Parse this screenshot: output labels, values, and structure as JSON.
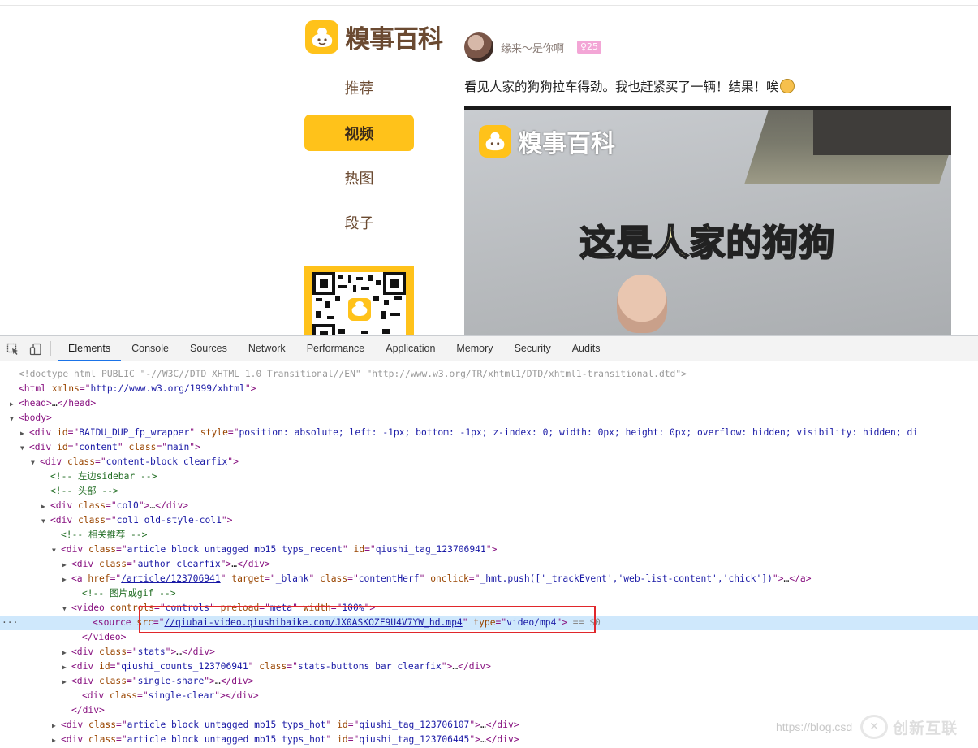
{
  "site": {
    "logo_text": "糗事百科",
    "nav": [
      "推荐",
      "视频",
      "热图",
      "段子"
    ],
    "active_nav": "视频"
  },
  "post": {
    "author_name": "缘来～是你啊",
    "author_age": "♀25",
    "text": "看见人家的狗狗拉车得劲。我也赶紧买了一辆！结果！唉",
    "video_watermark": "糗事百科",
    "video_caption": "这是人家的狗狗"
  },
  "devtools": {
    "tabs": [
      "Elements",
      "Console",
      "Sources",
      "Network",
      "Performance",
      "Application",
      "Memory",
      "Security",
      "Audits"
    ],
    "active_tab": "Elements",
    "lines": [
      {
        "indent": 0,
        "tri": "",
        "parts": [
          [
            "doc",
            "<!doctype html PUBLIC \"-//W3C//DTD XHTML 1.0 Transitional//EN\" \"http://www.w3.org/TR/xhtml1/DTD/xhtml1-transitional.dtd\">"
          ]
        ]
      },
      {
        "indent": 0,
        "tri": "",
        "parts": [
          [
            "tag",
            "<html "
          ],
          [
            "attr",
            "xmlns"
          ],
          [
            "tag",
            "=\""
          ],
          [
            "val",
            "http://www.w3.org/1999/xhtml"
          ],
          [
            "tag",
            "\">"
          ]
        ]
      },
      {
        "indent": 0,
        "tri": "▶",
        "parts": [
          [
            "tag",
            "<head>"
          ],
          [
            "",
            "…"
          ],
          [
            "tag",
            "</head>"
          ]
        ]
      },
      {
        "indent": 0,
        "tri": "▼",
        "parts": [
          [
            "tag",
            "<body>"
          ]
        ]
      },
      {
        "indent": 1,
        "tri": "▶",
        "parts": [
          [
            "tag",
            "<div "
          ],
          [
            "attr",
            "id"
          ],
          [
            "tag",
            "=\""
          ],
          [
            "val",
            "BAIDU_DUP_fp_wrapper"
          ],
          [
            "tag",
            "\" "
          ],
          [
            "attr",
            "style"
          ],
          [
            "tag",
            "=\""
          ],
          [
            "val",
            "position: absolute; left: -1px; bottom: -1px; z-index: 0; width: 0px; height: 0px; overflow: hidden; visibility: hidden; di"
          ]
        ]
      },
      {
        "indent": 1,
        "tri": "▼",
        "parts": [
          [
            "tag",
            "<div "
          ],
          [
            "attr",
            "id"
          ],
          [
            "tag",
            "=\""
          ],
          [
            "val",
            "content"
          ],
          [
            "tag",
            "\" "
          ],
          [
            "attr",
            "class"
          ],
          [
            "tag",
            "=\""
          ],
          [
            "val",
            "main"
          ],
          [
            "tag",
            "\">"
          ]
        ]
      },
      {
        "indent": 2,
        "tri": "▼",
        "parts": [
          [
            "tag",
            "<div "
          ],
          [
            "attr",
            "class"
          ],
          [
            "tag",
            "=\""
          ],
          [
            "val",
            "content-block clearfix"
          ],
          [
            "tag",
            "\">"
          ]
        ]
      },
      {
        "indent": 3,
        "tri": "",
        "parts": [
          [
            "cmt",
            "<!-- 左边sidebar -->"
          ]
        ]
      },
      {
        "indent": 3,
        "tri": "",
        "parts": [
          [
            "cmt",
            "<!-- 头部 -->"
          ]
        ]
      },
      {
        "indent": 3,
        "tri": "▶",
        "parts": [
          [
            "tag",
            "<div "
          ],
          [
            "attr",
            "class"
          ],
          [
            "tag",
            "=\""
          ],
          [
            "val",
            "col0"
          ],
          [
            "tag",
            "\">"
          ],
          [
            "",
            "…"
          ],
          [
            "tag",
            "</div>"
          ]
        ]
      },
      {
        "indent": 3,
        "tri": "▼",
        "parts": [
          [
            "tag",
            "<div "
          ],
          [
            "attr",
            "class"
          ],
          [
            "tag",
            "=\""
          ],
          [
            "val",
            "col1 old-style-col1"
          ],
          [
            "tag",
            "\">"
          ]
        ]
      },
      {
        "indent": 4,
        "tri": "",
        "parts": [
          [
            "cmt",
            "<!-- 相关推荐 -->"
          ]
        ]
      },
      {
        "indent": 4,
        "tri": "▼",
        "parts": [
          [
            "tag",
            "<div "
          ],
          [
            "attr",
            "class"
          ],
          [
            "tag",
            "=\""
          ],
          [
            "val",
            "article block untagged mb15 typs_recent"
          ],
          [
            "tag",
            "\" "
          ],
          [
            "attr",
            "id"
          ],
          [
            "tag",
            "=\""
          ],
          [
            "val",
            "qiushi_tag_123706941"
          ],
          [
            "tag",
            "\">"
          ]
        ]
      },
      {
        "indent": 5,
        "tri": "▶",
        "parts": [
          [
            "tag",
            "<div "
          ],
          [
            "attr",
            "class"
          ],
          [
            "tag",
            "=\""
          ],
          [
            "val",
            "author clearfix"
          ],
          [
            "tag",
            "\">"
          ],
          [
            "",
            "…"
          ],
          [
            "tag",
            "</div>"
          ]
        ]
      },
      {
        "indent": 5,
        "tri": "▶",
        "parts": [
          [
            "tag",
            "<a "
          ],
          [
            "attr",
            "href"
          ],
          [
            "tag",
            "=\""
          ],
          [
            "link",
            "/article/123706941"
          ],
          [
            "tag",
            "\" "
          ],
          [
            "attr",
            "target"
          ],
          [
            "tag",
            "=\""
          ],
          [
            "val",
            "_blank"
          ],
          [
            "tag",
            "\" "
          ],
          [
            "attr",
            "class"
          ],
          [
            "tag",
            "=\""
          ],
          [
            "val",
            "contentHerf"
          ],
          [
            "tag",
            "\" "
          ],
          [
            "attr",
            "onclick"
          ],
          [
            "tag",
            "=\""
          ],
          [
            "val",
            "_hmt.push(['_trackEvent','web-list-content','chick'])"
          ],
          [
            "tag",
            "\">"
          ],
          [
            "",
            "…"
          ],
          [
            "tag",
            "</a>"
          ]
        ]
      },
      {
        "indent": 6,
        "tri": "",
        "parts": [
          [
            "cmt",
            "<!-- 图片或gif -->"
          ]
        ]
      },
      {
        "indent": 5,
        "tri": "▼",
        "parts": [
          [
            "tag",
            "<video "
          ],
          [
            "attr",
            "controls"
          ],
          [
            "tag",
            "=\""
          ],
          [
            "val",
            "controls"
          ],
          [
            "tag",
            "\" "
          ],
          [
            "attr",
            "preload"
          ],
          [
            "tag",
            "=\""
          ],
          [
            "val",
            "meta"
          ],
          [
            "tag",
            "\" "
          ],
          [
            "attr",
            "width"
          ],
          [
            "tag",
            "=\""
          ],
          [
            "val",
            "100%"
          ],
          [
            "tag",
            "\">"
          ]
        ]
      },
      {
        "indent": 7,
        "tri": "",
        "sel": true,
        "parts": [
          [
            "tag",
            "<source "
          ],
          [
            "attr",
            "src"
          ],
          [
            "tag",
            "=\""
          ],
          [
            "link",
            "//qiubai-video.qiushibaike.com/JX0ASKOZF9U4V7YW_hd.mp4"
          ],
          [
            "tag",
            "\" "
          ],
          [
            "attr",
            "type"
          ],
          [
            "tag",
            "=\""
          ],
          [
            "val",
            "video/mp4"
          ],
          [
            "tag",
            "\">"
          ],
          [
            "eq",
            " == $0"
          ]
        ]
      },
      {
        "indent": 6,
        "tri": "",
        "parts": [
          [
            "tag",
            "</video>"
          ]
        ]
      },
      {
        "indent": 5,
        "tri": "▶",
        "parts": [
          [
            "tag",
            "<div "
          ],
          [
            "attr",
            "class"
          ],
          [
            "tag",
            "=\""
          ],
          [
            "val",
            "stats"
          ],
          [
            "tag",
            "\">"
          ],
          [
            "",
            "…"
          ],
          [
            "tag",
            "</div>"
          ]
        ]
      },
      {
        "indent": 5,
        "tri": "▶",
        "parts": [
          [
            "tag",
            "<div "
          ],
          [
            "attr",
            "id"
          ],
          [
            "tag",
            "=\""
          ],
          [
            "val",
            "qiushi_counts_123706941"
          ],
          [
            "tag",
            "\" "
          ],
          [
            "attr",
            "class"
          ],
          [
            "tag",
            "=\""
          ],
          [
            "val",
            "stats-buttons bar clearfix"
          ],
          [
            "tag",
            "\">"
          ],
          [
            "",
            "…"
          ],
          [
            "tag",
            "</div>"
          ]
        ]
      },
      {
        "indent": 5,
        "tri": "▶",
        "parts": [
          [
            "tag",
            "<div "
          ],
          [
            "attr",
            "class"
          ],
          [
            "tag",
            "=\""
          ],
          [
            "val",
            "single-share"
          ],
          [
            "tag",
            "\">"
          ],
          [
            "",
            "…"
          ],
          [
            "tag",
            "</div>"
          ]
        ]
      },
      {
        "indent": 6,
        "tri": "",
        "parts": [
          [
            "tag",
            "<div "
          ],
          [
            "attr",
            "class"
          ],
          [
            "tag",
            "=\""
          ],
          [
            "val",
            "single-clear"
          ],
          [
            "tag",
            "\">"
          ],
          [
            "tag",
            "</div>"
          ]
        ]
      },
      {
        "indent": 5,
        "tri": "",
        "parts": [
          [
            "tag",
            "</div>"
          ]
        ]
      },
      {
        "indent": 4,
        "tri": "▶",
        "parts": [
          [
            "tag",
            "<div "
          ],
          [
            "attr",
            "class"
          ],
          [
            "tag",
            "=\""
          ],
          [
            "val",
            "article block untagged mb15 typs_hot"
          ],
          [
            "tag",
            "\" "
          ],
          [
            "attr",
            "id"
          ],
          [
            "tag",
            "=\""
          ],
          [
            "val",
            "qiushi_tag_123706107"
          ],
          [
            "tag",
            "\">"
          ],
          [
            "",
            "…"
          ],
          [
            "tag",
            "</div>"
          ]
        ]
      },
      {
        "indent": 4,
        "tri": "▶",
        "parts": [
          [
            "tag",
            "<div "
          ],
          [
            "attr",
            "class"
          ],
          [
            "tag",
            "=\""
          ],
          [
            "val",
            "article block untagged mb15 typs_hot"
          ],
          [
            "tag",
            "\" "
          ],
          [
            "attr",
            "id"
          ],
          [
            "tag",
            "=\""
          ],
          [
            "val",
            "qiushi_tag_123706445"
          ],
          [
            "tag",
            "\">"
          ],
          [
            "",
            "…"
          ],
          [
            "tag",
            "</div>"
          ]
        ]
      }
    ]
  },
  "watermark": {
    "url": "https://blog.csd",
    "brand": "创新互联"
  },
  "colors": {
    "brand_yellow": "#ffc21a",
    "brand_brown": "#6b4a31",
    "highlight_box": "#e0272b",
    "selected_line": "#cfe8fc"
  }
}
